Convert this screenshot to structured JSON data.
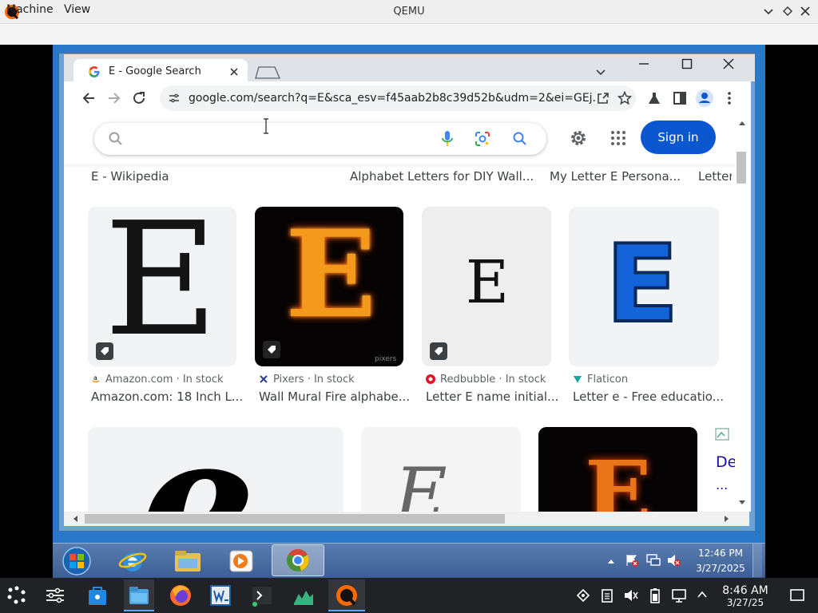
{
  "qemu": {
    "title": "QEMU",
    "menu": [
      "Machine",
      "View"
    ]
  },
  "browser": {
    "tab_title": "E - Google Search",
    "url": "google.com/search?q=E&sca_esv=f45aab2b8c39d52b&udm=2&ei=GEj...",
    "signin_label": "Sign in",
    "search_placeholder": ""
  },
  "results": {
    "row0": [
      {
        "caption": "E - Wikipedia"
      },
      {
        "caption": "Alphabet Letters for DIY Wall..."
      },
      {
        "caption": "My Letter E Persona..."
      },
      {
        "caption": "Letter"
      }
    ],
    "row1": [
      {
        "source": "Amazon.com · In stock",
        "caption": "Amazon.com: 18 Inch L...",
        "letter": "E"
      },
      {
        "source": "Pixers · In stock",
        "caption": "Wall Mural Fire alphabe...",
        "letter": "E",
        "watermark": "pixers"
      },
      {
        "source": "Redbubble · In stock",
        "caption": "Letter E name initial...",
        "letter": "E"
      },
      {
        "source": "Flaticon",
        "caption": "Letter e - Free educatio...",
        "letter": "E"
      }
    ],
    "row2_partial": [
      {
        "letter": "e"
      },
      {
        "letter": "E"
      },
      {
        "letter": "E"
      },
      {
        "text": "De",
        "more": "..."
      }
    ]
  },
  "guest_clock": {
    "time": "12:46 PM",
    "date": "3/27/2025"
  },
  "host_clock": {
    "time": "8:46 AM",
    "date": "3/27/25"
  },
  "colors": {
    "accent": "#0b57d0",
    "win_taskbar": "#3b5f95",
    "host_taskbar": "#212226"
  }
}
